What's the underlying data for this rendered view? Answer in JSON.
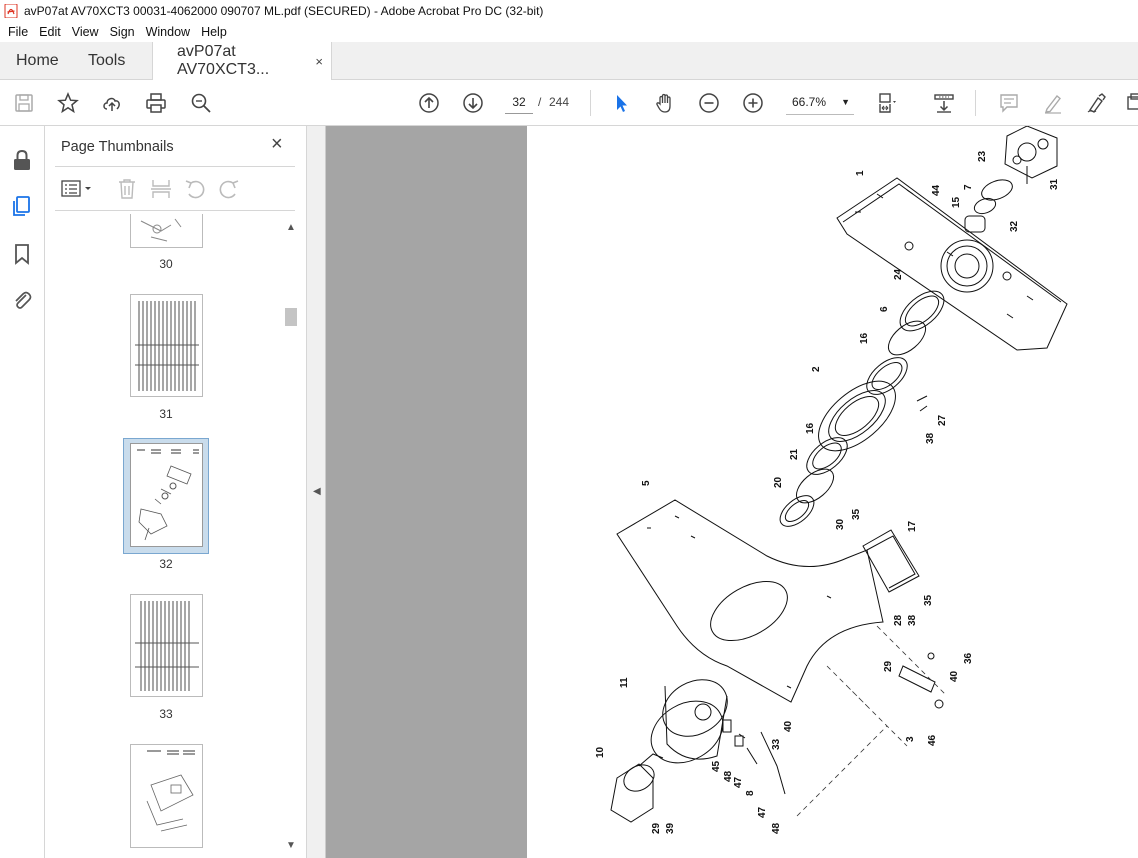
{
  "window": {
    "title": "avP07at AV70XCT3 00031-4062000 090707 ML.pdf (SECURED) - Adobe Acrobat Pro DC (32-bit)"
  },
  "menu": [
    "File",
    "Edit",
    "View",
    "Sign",
    "Window",
    "Help"
  ],
  "tabs": {
    "home": "Home",
    "tools": "Tools",
    "doc": "avP07at AV70XCT3...",
    "doc_close": "×"
  },
  "nav": {
    "current_page": "32",
    "separator": "/",
    "total_pages": "244"
  },
  "zoom": {
    "value": "66.7%"
  },
  "panel": {
    "title": "Page Thumbnails",
    "close": "×",
    "thumbnails": [
      {
        "num": "30",
        "selected": false
      },
      {
        "num": "31",
        "selected": false
      },
      {
        "num": "32",
        "selected": true
      },
      {
        "num": "33",
        "selected": false
      }
    ]
  },
  "drawing": {
    "labels": [
      "1",
      "23",
      "31",
      "7",
      "44",
      "15",
      "32",
      "24",
      "6",
      "16",
      "2",
      "27",
      "38",
      "16",
      "21",
      "20",
      "5",
      "30",
      "35",
      "17",
      "35",
      "38",
      "28",
      "29",
      "36",
      "40",
      "3",
      "46",
      "11",
      "40",
      "33",
      "10",
      "45",
      "48",
      "47",
      "8",
      "47",
      "48",
      "29",
      "39"
    ]
  }
}
